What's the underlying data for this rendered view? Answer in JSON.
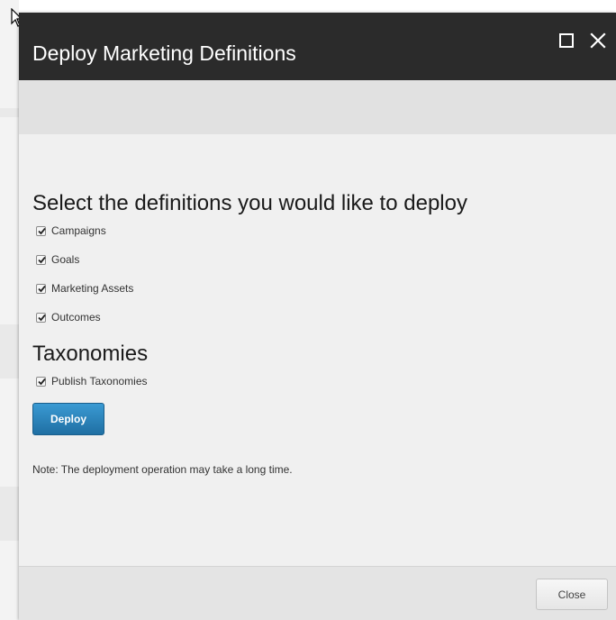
{
  "dialog": {
    "title": "Deploy Marketing Definitions"
  },
  "window_controls": {
    "maximize_icon": "maximize-icon",
    "close_icon": "close-icon"
  },
  "definitions": {
    "heading": "Select the definitions you would like to deploy",
    "items": [
      {
        "label": "Campaigns",
        "checked": true
      },
      {
        "label": "Goals",
        "checked": true
      },
      {
        "label": "Marketing Assets",
        "checked": true
      },
      {
        "label": "Outcomes",
        "checked": true
      }
    ]
  },
  "taxonomies": {
    "heading": "Taxonomies",
    "items": [
      {
        "label": "Publish Taxonomies",
        "checked": true
      }
    ]
  },
  "actions": {
    "deploy_label": "Deploy",
    "note": "Note: The deployment operation may take a long time.",
    "close_label": "Close"
  },
  "colors": {
    "titlebar": "#2b2b2b",
    "primary_button": "#2a86bf",
    "body_background": "#f0f0f0"
  }
}
